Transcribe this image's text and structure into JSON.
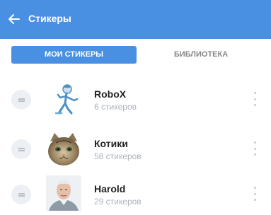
{
  "header": {
    "title": "Стикеры",
    "back_icon": "arrow-left-icon"
  },
  "tabs": [
    {
      "label": "МОИ СТИКЕРЫ",
      "active": true
    },
    {
      "label": "БИБЛИОТЕКА",
      "active": false
    }
  ],
  "sticker_packs": [
    {
      "name": "RoboX",
      "count": "6 стикеров",
      "thumb_icon": "robot-sticker-icon"
    },
    {
      "name": "Котики",
      "count": "58 стикеров",
      "thumb_icon": "cat-sticker-icon"
    },
    {
      "name": "Harold",
      "count": "29 стикеров",
      "thumb_icon": "harold-photo-icon"
    }
  ],
  "colors": {
    "accent": "#4a90e2"
  }
}
